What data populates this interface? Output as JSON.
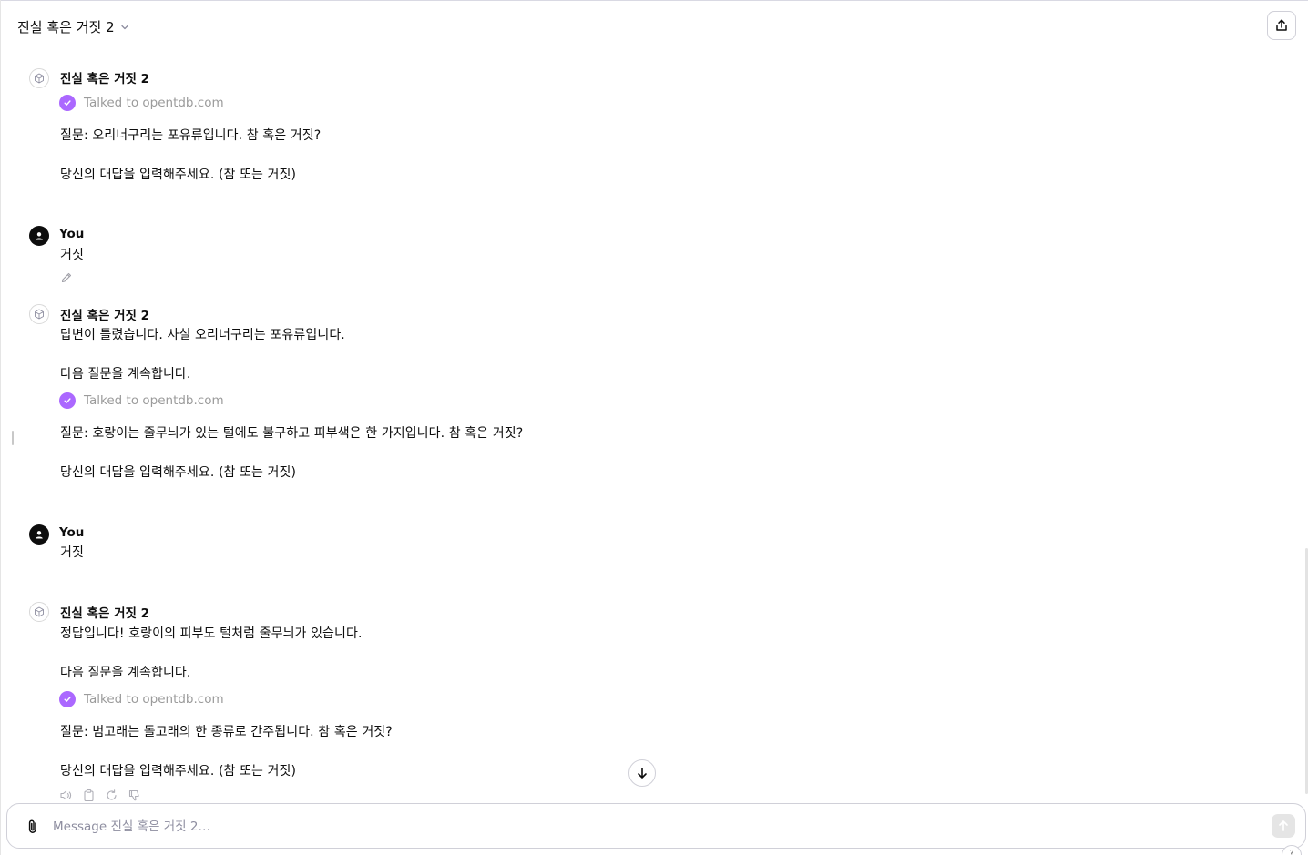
{
  "header": {
    "title": "진실 혹은 거짓 2"
  },
  "thread": {
    "gpt_name": "진실 혹은 거짓 2",
    "user_name": "You",
    "tool_text": "Talked to opentdb.com",
    "messages": [
      {
        "role": "assistant",
        "lines": [
          "질문: 오리너구리는 포유류입니다. 참 혹은 거짓?",
          "당신의 대답을 입력해주세요. (참 또는 거짓)"
        ]
      },
      {
        "role": "user",
        "text": "거짓"
      },
      {
        "role": "assistant",
        "intro": [
          "답변이 틀렸습니다. 사실 오리너구리는 포유류입니다.",
          "다음 질문을 계속합니다."
        ],
        "lines": [
          "질문: 호랑이는 줄무늬가 있는 털에도 불구하고 피부색은 한 가지입니다. 참 혹은 거짓?",
          "당신의 대답을 입력해주세요. (참 또는 거짓)"
        ]
      },
      {
        "role": "user",
        "text": "거짓"
      },
      {
        "role": "assistant",
        "intro": [
          "정답입니다! 호랑이의 피부도 털처럼 줄무늬가 있습니다.",
          "다음 질문을 계속합니다."
        ],
        "lines": [
          "질문: 범고래는 돌고래의 한 종류로 간주됩니다. 참 혹은 거짓?",
          "당신의 대답을 입력해주세요. (참 또는 거짓)"
        ]
      }
    ]
  },
  "composer": {
    "placeholder": "Message 진실 혹은 거짓 2…"
  },
  "help": {
    "label": "?"
  },
  "icons": {
    "share": "share-icon",
    "chevron": "chevron-down-icon",
    "bot_avatar": "cube-icon",
    "user_avatar": "user-icon",
    "check": "check-circle-icon",
    "edit": "pencil-icon",
    "speaker": "speaker-icon",
    "copy": "clipboard-icon",
    "regenerate": "refresh-icon",
    "dislike": "thumbs-down-icon",
    "scroll_down": "arrow-down-icon",
    "attach": "paperclip-icon",
    "send": "arrow-up-icon"
  },
  "colors": {
    "tool_check": "#ab68ff",
    "tool_text": "#9b9b9b"
  }
}
